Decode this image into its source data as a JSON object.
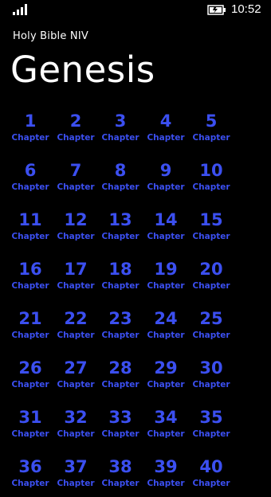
{
  "status_bar": {
    "signal_icon": "signal-strength-icon",
    "battery_icon": "battery-charging-icon",
    "time": "10:52"
  },
  "header": {
    "app_title": "Holy Bible NIV",
    "book_title": "Genesis"
  },
  "accent_color": "#3b4ff0",
  "chapter_label": "Chapter",
  "chapters": [
    "1",
    "2",
    "3",
    "4",
    "5",
    "6",
    "7",
    "8",
    "9",
    "10",
    "11",
    "12",
    "13",
    "14",
    "15",
    "16",
    "17",
    "18",
    "19",
    "20",
    "21",
    "22",
    "23",
    "24",
    "25",
    "26",
    "27",
    "28",
    "29",
    "30",
    "31",
    "32",
    "33",
    "34",
    "35",
    "36",
    "37",
    "38",
    "39",
    "40"
  ]
}
